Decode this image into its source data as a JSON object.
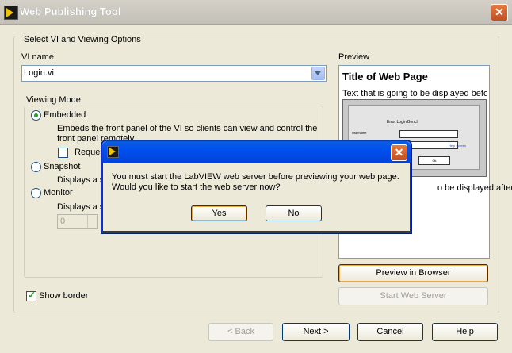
{
  "window": {
    "title": "Web Publishing Tool",
    "close_glyph": "✕"
  },
  "options": {
    "group_label": "Select VI and Viewing Options",
    "vi_name_label": "VI name",
    "vi_name_value": "Login.vi",
    "viewing_mode_label": "Viewing Mode",
    "modes": [
      {
        "label": "Embedded",
        "selected": true,
        "desc1": "Embeds the front panel of the VI so clients can view and control the",
        "desc2": "front panel remotely."
      },
      {
        "label": "Snapshot",
        "selected": false,
        "desc1": "Displays a s"
      },
      {
        "label": "Monitor",
        "selected": false,
        "desc1": "Displays a s"
      }
    ],
    "request_label": "Reques",
    "monitor_interval": "0",
    "show_border_label": "Show border",
    "show_border_checked": true
  },
  "preview": {
    "label": "Preview",
    "title": "Title of Web Page",
    "text_before": "Text that is going to be displayed befo...",
    "text_after": "o be displayed after ...",
    "thumb": {
      "heading": "Error Login Bench",
      "field_label": "Username",
      "ok": "Ok",
      "link": "Help Screen"
    },
    "browser_button": "Preview in Browser",
    "server_button": "Start Web Server"
  },
  "footer": {
    "back": "< Back",
    "next": "Next >",
    "cancel": "Cancel",
    "help": "Help"
  },
  "modal": {
    "close_glyph": "✕",
    "message_line1": "You must start the LabVIEW web server before previewing your web page.",
    "message_line2": "Would you like to start the web server now?",
    "yes": "Yes",
    "no": "No"
  },
  "colors": {
    "xp_blue": "#0050ee",
    "dialog_bg": "#ece9d8",
    "close_red": "#c24e22"
  }
}
